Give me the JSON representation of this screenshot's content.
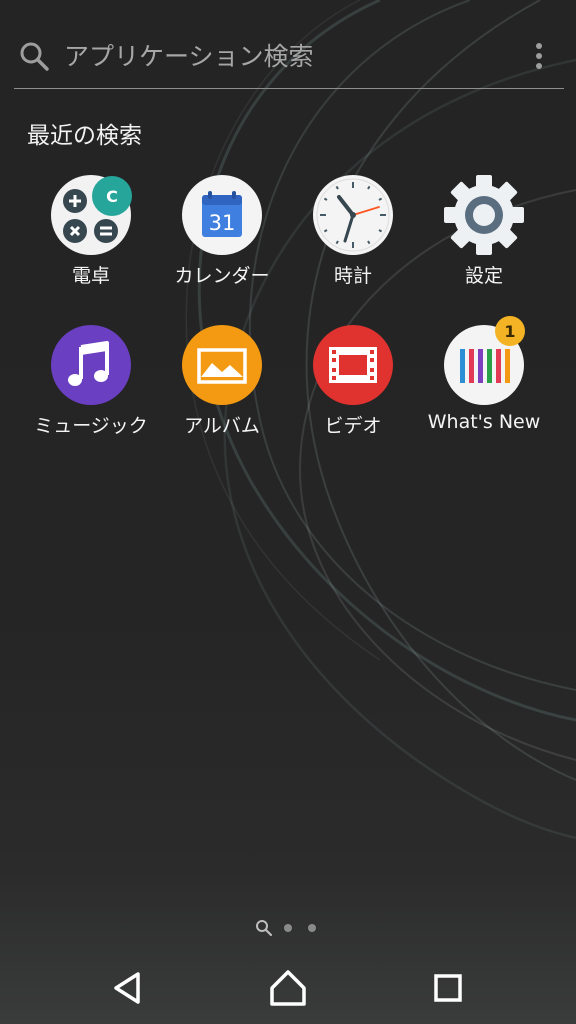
{
  "search": {
    "placeholder": "アプリケーション検索",
    "icon": "search-icon",
    "menu_icon": "more-vert-icon"
  },
  "recent": {
    "title": "最近の検索"
  },
  "apps": [
    {
      "label": "電卓",
      "icon": "calculator-icon"
    },
    {
      "label": "カレンダー",
      "icon": "calendar-icon",
      "day": "31"
    },
    {
      "label": "時計",
      "icon": "clock-icon"
    },
    {
      "label": "設定",
      "icon": "settings-gear-icon"
    },
    {
      "label": "ミュージック",
      "icon": "music-note-icon"
    },
    {
      "label": "アルバム",
      "icon": "album-photo-icon"
    },
    {
      "label": "ビデオ",
      "icon": "video-film-icon"
    },
    {
      "label": "What's New",
      "icon": "whats-new-icon",
      "badge": "1"
    }
  ],
  "calculator": {
    "badge": "C"
  },
  "pager": {
    "pages": 3,
    "current": 0
  },
  "navbar": {
    "back": "back-icon",
    "home": "home-icon",
    "recents": "recents-icon"
  },
  "colors": {
    "background": "#262626",
    "calc_teal": "#26a69a",
    "calendar_blue": "#3f7fe0",
    "music_purple": "#6a3fc2",
    "album_orange": "#f39a12",
    "video_red": "#e0322f",
    "badge_gold": "#f4b324",
    "settings_gray": "#5a6e80"
  }
}
